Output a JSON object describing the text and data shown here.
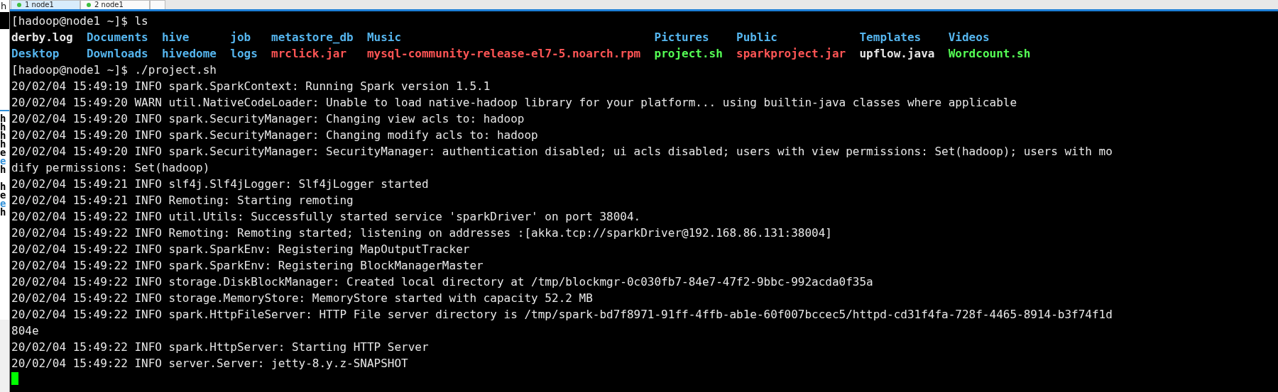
{
  "tabs": [
    {
      "label": "1 node1",
      "selected": true
    },
    {
      "label": "2 node1",
      "selected": false
    }
  ],
  "side_window": {
    "top_letter": "h",
    "letters": [
      {
        "text": "h",
        "color": "#000000"
      },
      {
        "text": "h",
        "color": "#000000"
      },
      {
        "text": "h",
        "color": "#000000"
      },
      {
        "text": "h",
        "color": "#000000"
      },
      {
        "text": "e",
        "color": "#000000"
      },
      {
        "text": "e",
        "color": "#2f8fd8"
      },
      {
        "text": "h",
        "color": "#000000"
      },
      {
        "text": "h",
        "color": "#000000"
      },
      {
        "text": "e",
        "color": "#000000"
      },
      {
        "text": "e",
        "color": "#2f8fd8"
      },
      {
        "text": "h",
        "color": "#000000"
      }
    ]
  },
  "terminal": {
    "lines": [
      {
        "kind": "text",
        "text": "[hadoop@node1 ~]$ ls"
      },
      {
        "kind": "listing",
        "rows": [
          [
            {
              "text": "derby.log",
              "color": "#e6e6e6"
            },
            {
              "text": "Documents",
              "color": "#55b5ee"
            },
            {
              "text": "hive",
              "color": "#55b5ee"
            },
            {
              "text": "job",
              "color": "#55b5ee"
            },
            {
              "text": "metastore_db",
              "color": "#55b5ee"
            },
            {
              "text": "Music",
              "color": "#55b5ee"
            },
            {
              "text": "Pictures",
              "color": "#55b5ee"
            },
            {
              "text": "Public",
              "color": "#55b5ee"
            },
            {
              "text": "Templates",
              "color": "#55b5ee"
            },
            {
              "text": "Videos",
              "color": "#55b5ee"
            }
          ],
          [
            {
              "text": "Desktop",
              "color": "#55b5ee"
            },
            {
              "text": "Downloads",
              "color": "#55b5ee"
            },
            {
              "text": "hivedome",
              "color": "#55b5ee"
            },
            {
              "text": "logs",
              "color": "#55b5ee"
            },
            {
              "text": "mrclick.jar",
              "color": "#ff5555"
            },
            {
              "text": "mysql-community-release-el7-5.noarch.rpm",
              "color": "#ff5555"
            },
            {
              "text": "project.sh",
              "color": "#55ff55"
            },
            {
              "text": "sparkproject.jar",
              "color": "#ff5555"
            },
            {
              "text": "upflow.java",
              "color": "#e6e6e6"
            },
            {
              "text": "Wordcount.sh",
              "color": "#55ff55"
            }
          ]
        ]
      },
      {
        "kind": "text",
        "text": "[hadoop@node1 ~]$ ./project.sh"
      },
      {
        "kind": "text",
        "text": "20/02/04 15:49:19 INFO spark.SparkContext: Running Spark version 1.5.1"
      },
      {
        "kind": "text",
        "text": "20/02/04 15:49:20 WARN util.NativeCodeLoader: Unable to load native-hadoop library for your platform... using builtin-java classes where applicable"
      },
      {
        "kind": "text",
        "text": "20/02/04 15:49:20 INFO spark.SecurityManager: Changing view acls to: hadoop"
      },
      {
        "kind": "text",
        "text": "20/02/04 15:49:20 INFO spark.SecurityManager: Changing modify acls to: hadoop"
      },
      {
        "kind": "text",
        "text": "20/02/04 15:49:20 INFO spark.SecurityManager: SecurityManager: authentication disabled; ui acls disabled; users with view permissions: Set(hadoop); users with mo"
      },
      {
        "kind": "text",
        "text": "dify permissions: Set(hadoop)"
      },
      {
        "kind": "text",
        "text": "20/02/04 15:49:21 INFO slf4j.Slf4jLogger: Slf4jLogger started"
      },
      {
        "kind": "text",
        "text": "20/02/04 15:49:21 INFO Remoting: Starting remoting"
      },
      {
        "kind": "text",
        "text": "20/02/04 15:49:22 INFO util.Utils: Successfully started service 'sparkDriver' on port 38004."
      },
      {
        "kind": "text",
        "text": "20/02/04 15:49:22 INFO Remoting: Remoting started; listening on addresses :[akka.tcp://sparkDriver@192.168.86.131:38004]"
      },
      {
        "kind": "text",
        "text": "20/02/04 15:49:22 INFO spark.SparkEnv: Registering MapOutputTracker"
      },
      {
        "kind": "text",
        "text": "20/02/04 15:49:22 INFO spark.SparkEnv: Registering BlockManagerMaster"
      },
      {
        "kind": "text",
        "text": "20/02/04 15:49:22 INFO storage.DiskBlockManager: Created local directory at /tmp/blockmgr-0c030fb7-84e7-47f2-9bbc-992acda0f35a"
      },
      {
        "kind": "text",
        "text": "20/02/04 15:49:22 INFO storage.MemoryStore: MemoryStore started with capacity 52.2 MB"
      },
      {
        "kind": "text",
        "text": "20/02/04 15:49:22 INFO spark.HttpFileServer: HTTP File server directory is /tmp/spark-bd7f8971-91ff-4ffb-ab1e-60f007bccec5/httpd-cd31f4fa-728f-4465-8914-b3f74f1d"
      },
      {
        "kind": "text",
        "text": "804e"
      },
      {
        "kind": "text",
        "text": "20/02/04 15:49:22 INFO spark.HttpServer: Starting HTTP Server"
      },
      {
        "kind": "text",
        "text": "20/02/04 15:49:22 INFO server.Server: jetty-8.y.z-SNAPSHOT"
      },
      {
        "kind": "cursor"
      }
    ]
  }
}
